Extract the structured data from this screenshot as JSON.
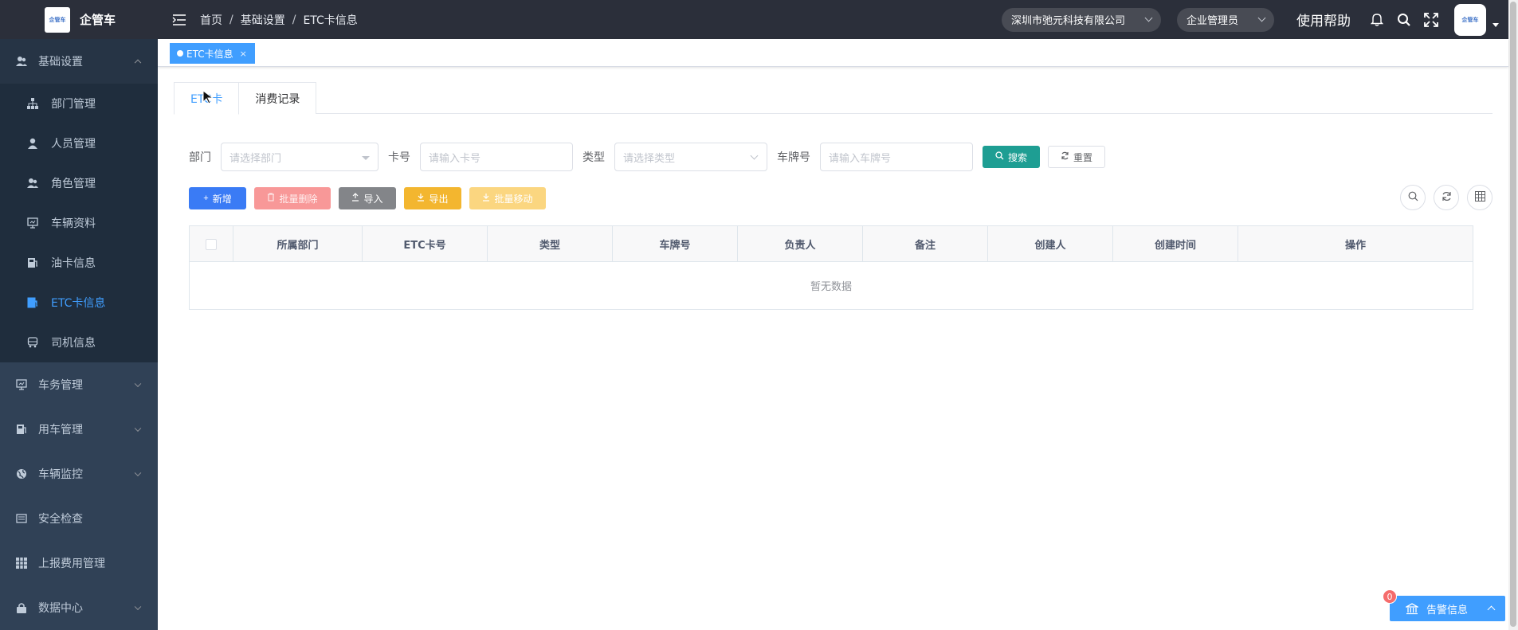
{
  "app": {
    "logo_text": "企管车",
    "logo_mark": "企管车"
  },
  "sidebar": {
    "groups": [
      {
        "label": "基础设置",
        "open": true,
        "icon": "people-icon"
      },
      {
        "label": "车务管理",
        "icon": "car-affairs-icon"
      },
      {
        "label": "用车管理",
        "icon": "car-use-icon"
      },
      {
        "label": "车辆监控",
        "icon": "globe-icon"
      },
      {
        "label": "安全检查",
        "icon": "checklist-icon"
      },
      {
        "label": "上报费用管理",
        "icon": "grid-icon"
      },
      {
        "label": "数据中心",
        "icon": "lock-icon"
      }
    ],
    "sub_items": [
      {
        "label": "部门管理",
        "icon": "org-chart-icon"
      },
      {
        "label": "人员管理",
        "icon": "user-icon"
      },
      {
        "label": "角色管理",
        "icon": "people-icon"
      },
      {
        "label": "车辆资料",
        "icon": "monitor-icon"
      },
      {
        "label": "油卡信息",
        "icon": "fuel-card-icon"
      },
      {
        "label": "ETC卡信息",
        "icon": "etc-card-icon",
        "active": true
      },
      {
        "label": "司机信息",
        "icon": "bus-icon"
      }
    ]
  },
  "header": {
    "breadcrumb": [
      "首页",
      "基础设置",
      "ETC卡信息"
    ],
    "company": "深圳市弛元科技有限公司",
    "role": "企业管理员",
    "help": "使用帮助",
    "avatar_mark": "企管车"
  },
  "tags": [
    {
      "label": "ETC卡信息",
      "close": "×"
    }
  ],
  "tabs": [
    {
      "label": "ETC卡",
      "active": true
    },
    {
      "label": "消费记录"
    }
  ],
  "search": {
    "dept_label": "部门",
    "dept_placeholder": "请选择部门",
    "card_label": "卡号",
    "card_placeholder": "请输入卡号",
    "type_label": "类型",
    "type_placeholder": "请选择类型",
    "plate_label": "车牌号",
    "plate_placeholder": "请输入车牌号",
    "search_btn": "搜索",
    "reset_btn": "重置"
  },
  "toolbar": {
    "add": "新增",
    "batch_delete": "批量删除",
    "import": "导入",
    "export": "导出",
    "batch_move": "批量移动"
  },
  "table": {
    "columns": [
      "所属部门",
      "ETC卡号",
      "类型",
      "车牌号",
      "负责人",
      "备注",
      "创建人",
      "创建时间",
      "操作"
    ],
    "empty_text": "暂无数据"
  },
  "alarm": {
    "label": "告警信息",
    "count": "0"
  },
  "colors": {
    "sidebar_bg": "#304156",
    "header_bg": "#2b2f3a",
    "primary": "#409eff",
    "search_btn": "#1e9e93"
  }
}
